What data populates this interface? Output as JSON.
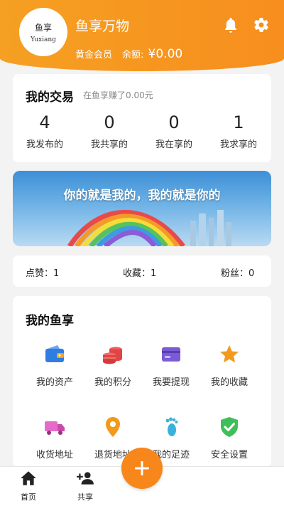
{
  "profile": {
    "avatar_cn": "鱼享",
    "avatar_en": "Yuxiang",
    "nickname": "鱼享万物",
    "member_label": "黄金会员",
    "balance_label": "余额:",
    "balance_value": "¥0.00",
    "icons": [
      "bell-icon",
      "settings-gear-icon"
    ]
  },
  "trade": {
    "title": "我的交易",
    "subtitle": "在鱼享赚了0.00元",
    "stats": [
      {
        "value": "4",
        "label": "我发布的"
      },
      {
        "value": "0",
        "label": "我共享的"
      },
      {
        "value": "0",
        "label": "我在享的"
      },
      {
        "value": "1",
        "label": "我求享的"
      }
    ]
  },
  "banner": {
    "slogan": "你的就是我的，我的就是你的"
  },
  "social": {
    "likes": "点赞：1",
    "favorites": "收藏：1",
    "fans": "粉丝：0"
  },
  "mine": {
    "title": "我的鱼享",
    "items": [
      {
        "label": "我的资产",
        "icon": "wallet-icon"
      },
      {
        "label": "我的积分",
        "icon": "coins-icon"
      },
      {
        "label": "我要提现",
        "icon": "card-icon"
      },
      {
        "label": "我的收藏",
        "icon": "star-icon"
      },
      {
        "label": "收货地址",
        "icon": "truck-icon"
      },
      {
        "label": "退货地址",
        "icon": "location-pin-icon"
      },
      {
        "label": "我的足迹",
        "icon": "footprint-icon"
      },
      {
        "label": "安全设置",
        "icon": "shield-check-icon"
      }
    ]
  },
  "tabbar": {
    "home": "首页",
    "share": "共享",
    "fab_icon": "plus-icon"
  },
  "colors": {
    "accent": "#f7861b",
    "header": "#f5a022"
  }
}
